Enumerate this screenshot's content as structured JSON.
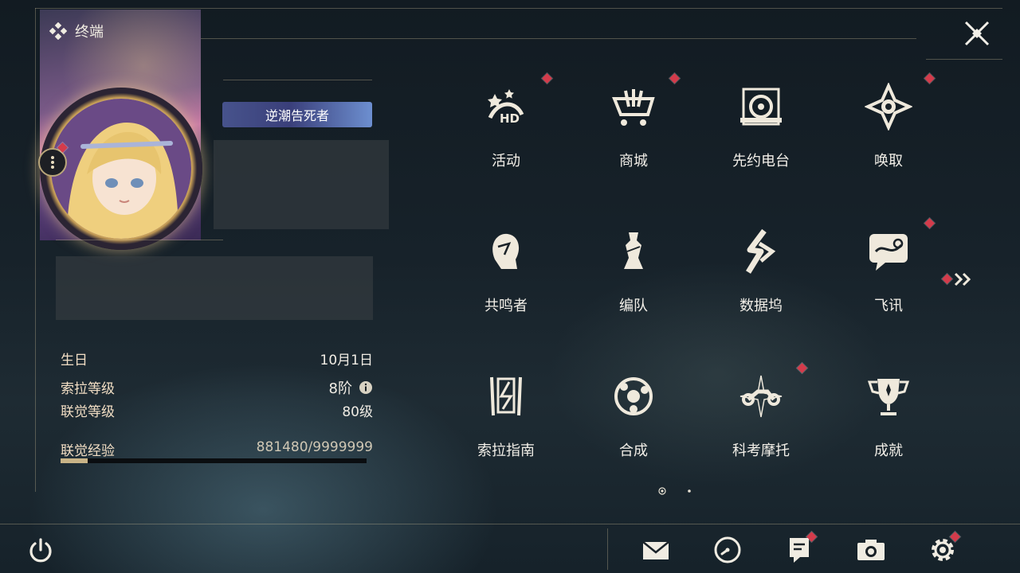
{
  "header": {
    "title": "终端"
  },
  "profile": {
    "title_badge": "逆潮告死者",
    "fields": [
      {
        "label": "生日",
        "value": "10月1日"
      },
      {
        "label": "索拉等级",
        "value": "8阶"
      },
      {
        "label": "联觉等级",
        "value": "80级"
      }
    ],
    "exp": {
      "label": "联觉经验",
      "value": "881480/9999999",
      "progress": 0.088
    }
  },
  "menu": {
    "items": [
      {
        "label": "活动",
        "icon": "event-icon",
        "badge": true
      },
      {
        "label": "商城",
        "icon": "shop-icon",
        "badge": true
      },
      {
        "label": "先约电台",
        "icon": "radio-icon",
        "badge": false
      },
      {
        "label": "唤取",
        "icon": "summon-icon",
        "badge": true
      },
      {
        "label": "共鸣者",
        "icon": "resonator-icon",
        "badge": false
      },
      {
        "label": "编队",
        "icon": "team-icon",
        "badge": false
      },
      {
        "label": "数据坞",
        "icon": "data-bank-icon",
        "badge": false
      },
      {
        "label": "飞讯",
        "icon": "message-icon",
        "badge": true
      },
      {
        "label": "索拉指南",
        "icon": "guide-icon",
        "badge": false
      },
      {
        "label": "合成",
        "icon": "synthesis-icon",
        "badge": false
      },
      {
        "label": "科考摩托",
        "icon": "motorcycle-icon",
        "badge": true
      },
      {
        "label": "成就",
        "icon": "achievement-icon",
        "badge": false
      }
    ],
    "page": 1,
    "page_count": 2
  },
  "bottom_bar": {
    "icons": [
      "mail-icon",
      "clock-icon",
      "notice-icon",
      "camera-icon",
      "settings-icon"
    ]
  },
  "colors": {
    "badge": "#d43b4b",
    "accent_gold": "#c9b487"
  }
}
